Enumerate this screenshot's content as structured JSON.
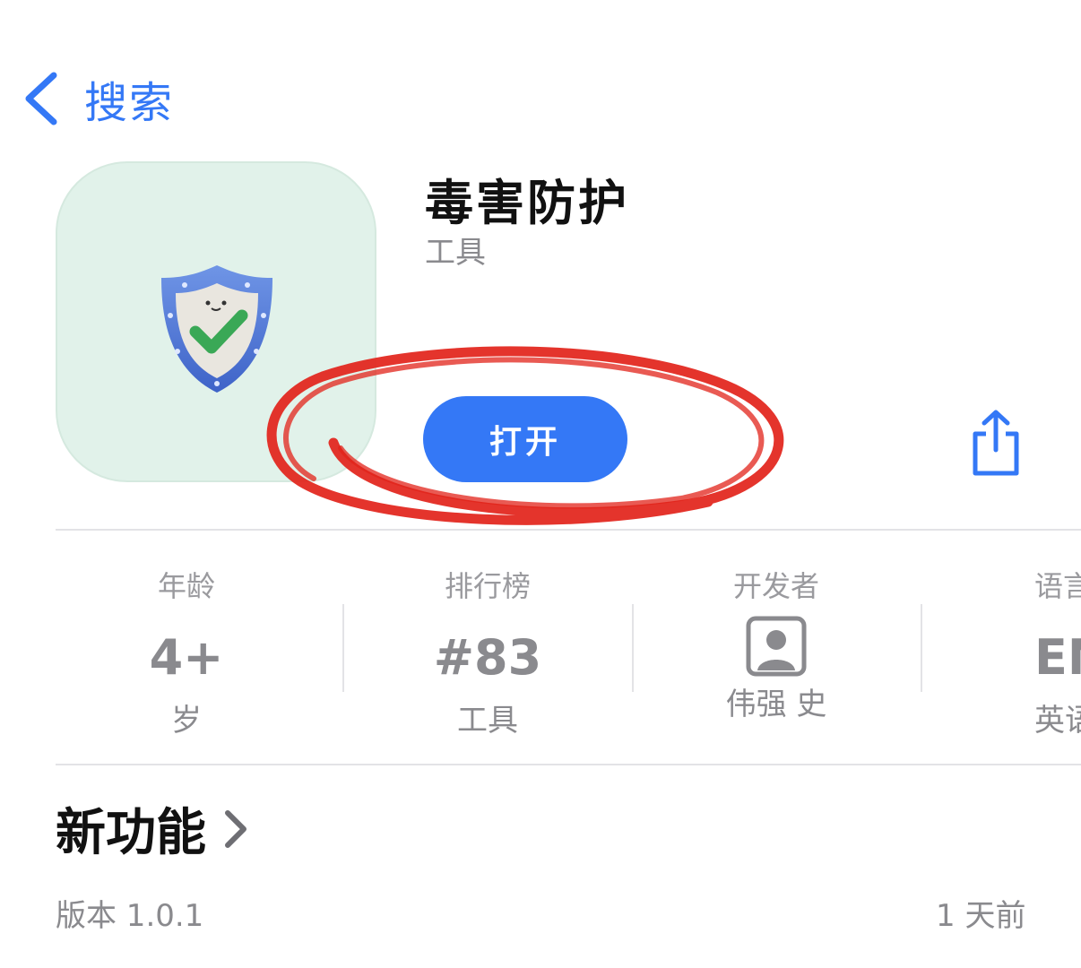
{
  "nav": {
    "back_label": "搜索",
    "back_icon": "chevron-left-icon",
    "accent": "#3478f6"
  },
  "app": {
    "name": "毒害防护",
    "category": "工具",
    "icon": "shield-check-icon",
    "icon_background": "#e1f2ea",
    "open_label": "打开",
    "share_icon": "share-icon"
  },
  "stats": [
    {
      "label": "年龄",
      "value": "4+",
      "sub": "岁"
    },
    {
      "label": "排行榜",
      "value": "#83",
      "sub": "工具"
    },
    {
      "label": "开发者",
      "value_icon": "person-icon",
      "sub": "伟强 史"
    },
    {
      "label": "语言",
      "value": "EN",
      "sub": "英语"
    }
  ],
  "whats_new": {
    "title": "新功能",
    "chevron": "chevron-right-icon",
    "version": "版本 1.0.1",
    "updated": "1 天前"
  },
  "annotation": {
    "color": "#e2231a",
    "shape": "hand-drawn circle around open button"
  }
}
